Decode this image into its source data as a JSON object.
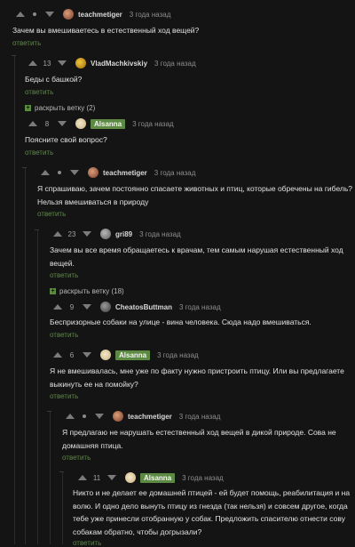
{
  "reply_label": "ответить",
  "colors": {
    "accent": "#5d8a43",
    "background": "#141414"
  },
  "comments": [
    {
      "id": "c1",
      "author": "teachmetiger",
      "time": "3 года назад",
      "count": "",
      "text_lines": [
        "Зачем вы вмешиваетесь в естественный ход вещей?"
      ]
    },
    {
      "id": "c2",
      "author": "VladMachkivskiy",
      "time": "3 года назад",
      "count": "13",
      "text_lines": [
        "Беды с башкой?"
      ]
    },
    {
      "id": "c3",
      "author": "Alsanna",
      "time": "3 года назад",
      "count": "8",
      "text_lines": [
        "Поясните свой вопрос?"
      ]
    },
    {
      "id": "c4",
      "author": "teachmetiger",
      "time": "3 года назад",
      "count": "",
      "text_lines": [
        "Я спрашиваю, зачем постоянно спасаете животных и птиц, которые обречены на гибель?",
        "Нельзя вмешиваться в природу"
      ]
    },
    {
      "id": "c5",
      "author": "gri89",
      "time": "3 года назад",
      "count": "23",
      "text_lines": [
        "Зачем вы все время обращаетесь к врачам, тем самым нарушая естественный ход",
        "вещей."
      ]
    },
    {
      "id": "c6",
      "author": "CheatosButtman",
      "time": "3 года назад",
      "count": "9",
      "text_lines": [
        "Беспризорные собаки на улице - вина человека. Сюда надо вмешиваться."
      ]
    },
    {
      "id": "c7",
      "author": "Alsanna",
      "time": "3 года назад",
      "count": "6",
      "text_lines": [
        "Я не вмешивалась, мне уже по факту нужно пристроить птицу. Или вы предлагаете",
        "выкинуть ее на помойку?"
      ]
    },
    {
      "id": "c8",
      "author": "teachmetiger",
      "time": "3 года назад",
      "count": "",
      "text_lines": [
        "Я предлагаю не нарушать естественный ход вещей в дикой природе. Сова не",
        "домашняя птица."
      ]
    },
    {
      "id": "c9",
      "author": "Alsanna",
      "time": "3 года назад",
      "count": "11",
      "text_lines": [
        "Никто и не делает ее домашней птицей - ей будет помощь, реабилитация и на",
        "волю. И одно дело вынуть птицу из гнезда (так нельзя) и совсем другое, когда",
        "тебе уже принесли отобранную у собак. Предложить спасителю отнести сову",
        "собакам обратно, чтобы догрызали?"
      ]
    }
  ],
  "expanders": [
    {
      "label": "раскрыть ветку (2)"
    },
    {
      "label": "раскрыть ветку (18)"
    }
  ]
}
